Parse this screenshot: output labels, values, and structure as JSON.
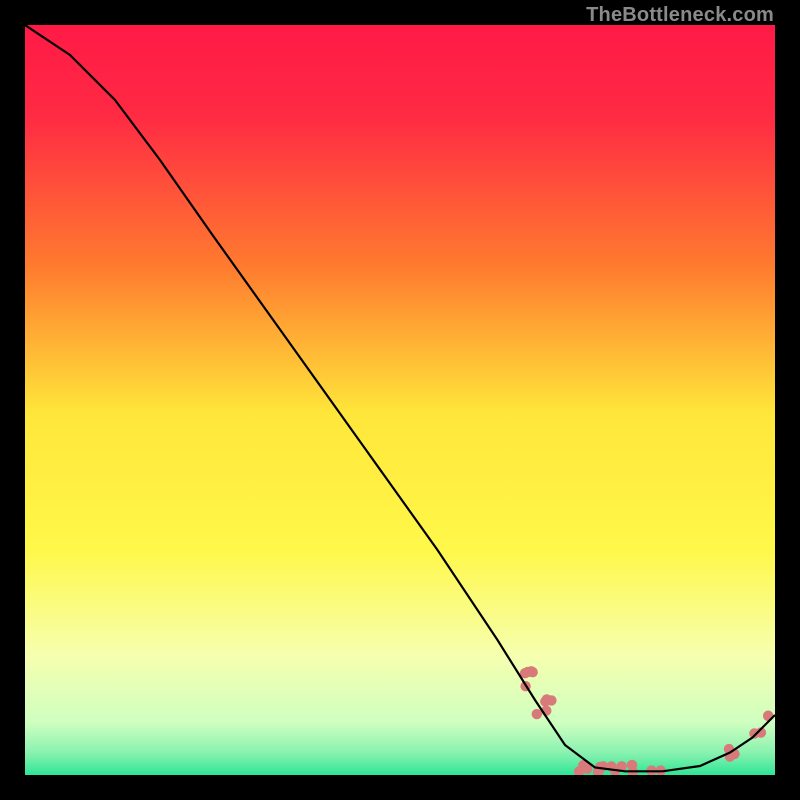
{
  "attribution": "TheBottleneck.com",
  "colors": {
    "dot": "#d87a7a",
    "line": "#000000",
    "frame": "#000000",
    "gradient_top": "#ff1a46",
    "gradient_mid_upper": "#ff8a2a",
    "gradient_mid": "#ffe73a",
    "gradient_lower": "#f3ffb0",
    "gradient_bottom": "#2fe596"
  },
  "chart_data": {
    "type": "line",
    "title": "",
    "xlabel": "",
    "ylabel": "",
    "xlim": [
      0,
      100
    ],
    "ylim": [
      0,
      100
    ],
    "curve": [
      {
        "x": 0,
        "y": 100
      },
      {
        "x": 6,
        "y": 96
      },
      {
        "x": 12,
        "y": 90
      },
      {
        "x": 18,
        "y": 82
      },
      {
        "x": 25,
        "y": 72
      },
      {
        "x": 35,
        "y": 58
      },
      {
        "x": 45,
        "y": 44
      },
      {
        "x": 55,
        "y": 30
      },
      {
        "x": 63,
        "y": 18
      },
      {
        "x": 68,
        "y": 10
      },
      {
        "x": 72,
        "y": 4
      },
      {
        "x": 76,
        "y": 1
      },
      {
        "x": 80,
        "y": 0.5
      },
      {
        "x": 85,
        "y": 0.5
      },
      {
        "x": 90,
        "y": 1.2
      },
      {
        "x": 94,
        "y": 3
      },
      {
        "x": 97,
        "y": 5
      },
      {
        "x": 100,
        "y": 8
      }
    ],
    "dot_clusters": [
      {
        "cx": 66.5,
        "cy": 13.0,
        "n": 5,
        "spread": 1.3
      },
      {
        "cx": 69.0,
        "cy": 9.0,
        "n": 5,
        "spread": 1.2
      },
      {
        "cx": 79.0,
        "cy": 0.9,
        "n": 14,
        "spread_x": 6.0,
        "spread_y": 0.5
      },
      {
        "cx": 94.0,
        "cy": 3.0,
        "n": 3,
        "spread": 0.8
      },
      {
        "cx": 97.5,
        "cy": 5.5,
        "n": 2,
        "spread": 0.7
      },
      {
        "cx": 99.0,
        "cy": 7.5,
        "n": 2,
        "spread": 0.7
      }
    ]
  }
}
